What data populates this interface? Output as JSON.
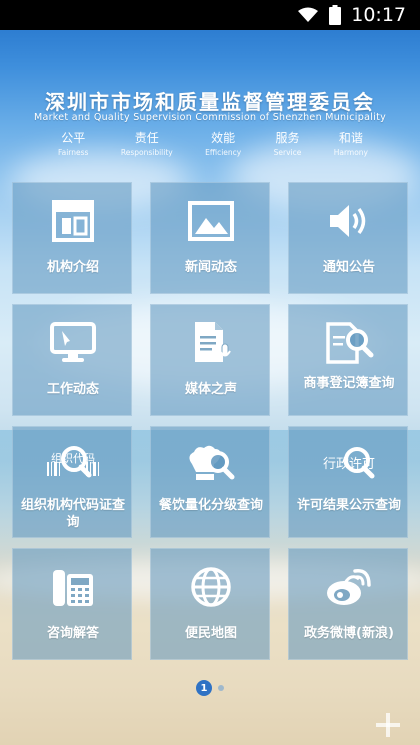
{
  "status_bar": {
    "time": "10:17",
    "wifi_icon": "wifi-icon",
    "battery_icon": "battery-icon"
  },
  "header": {
    "title_cn": "深圳市市场和质量监督管理委员会",
    "title_en": "Market and Quality Supervision Commission of Shenzhen Municipality",
    "values": [
      {
        "cn": "公平",
        "en": "Fairness"
      },
      {
        "cn": "责任",
        "en": "Responsibility"
      },
      {
        "cn": "效能",
        "en": "Efficiency"
      },
      {
        "cn": "服务",
        "en": "Service"
      },
      {
        "cn": "和谐",
        "en": "Harmony"
      }
    ]
  },
  "tiles": [
    {
      "label": "机构介绍",
      "icon": "layout-icon"
    },
    {
      "label": "新闻动态",
      "icon": "image-icon"
    },
    {
      "label": "通知公告",
      "icon": "speaker-icon"
    },
    {
      "label": "工作动态",
      "icon": "monitor-icon"
    },
    {
      "label": "媒体之声",
      "icon": "document-mic-icon"
    },
    {
      "label": "商事登记簿查询",
      "icon": "document-search-icon"
    },
    {
      "label": "组织机构代码证查询",
      "icon": "barcode-search-icon"
    },
    {
      "label": "餐饮量化分级查询",
      "icon": "chef-search-icon"
    },
    {
      "label": "许可结果公示查询",
      "icon": "license-search-icon"
    },
    {
      "label": "咨询解答",
      "icon": "phone-icon"
    },
    {
      "label": "便民地图",
      "icon": "globe-icon"
    },
    {
      "label": "政务微博(新浪)",
      "icon": "weibo-icon"
    }
  ],
  "tile_overlays": {
    "barcode_text": "组织代码",
    "chef_hat_text": "",
    "license_text": "行政许可"
  },
  "pager": {
    "current_page": "1",
    "total_pages": 2
  },
  "fab": {
    "icon": "plus-icon"
  },
  "colors": {
    "tile_bg": "#5f96be",
    "pager_active": "#2f72c4",
    "status_bar": "#000000"
  }
}
